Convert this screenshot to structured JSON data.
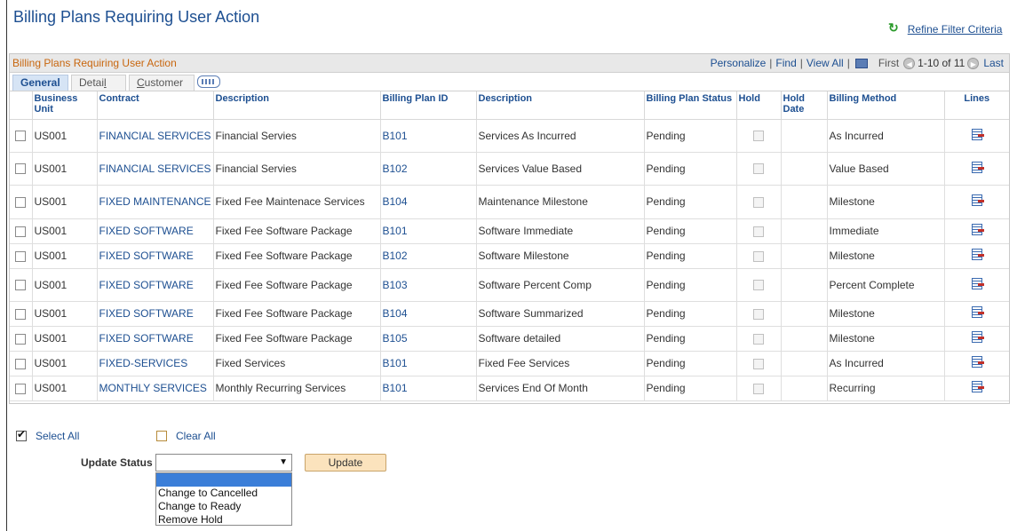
{
  "page": {
    "title": "Billing Plans Requiring User Action",
    "refine_label": "Refine Filter Criteria"
  },
  "grid": {
    "title": "Billing Plans Requiring User Action",
    "personalize": "Personalize",
    "find": "Find",
    "view_all": "View All",
    "first": "First",
    "range": "1-10 of 11",
    "last": "Last"
  },
  "tabs": {
    "general": "General",
    "detail_a": "Detai",
    "detail_b": "l",
    "customer_a": "C",
    "customer_b": "ustomer"
  },
  "columns": {
    "business_unit": "Business Unit",
    "contract": "Contract",
    "description": "Description",
    "plan_id": "Billing Plan ID",
    "plan_desc": "Description",
    "status": "Billing Plan Status",
    "hold": "Hold",
    "hold_date": "Hold Date",
    "method": "Billing Method",
    "lines": "Lines"
  },
  "rows": [
    {
      "bu": "US001",
      "contract": "FINANCIAL SERVICES",
      "desc": "Financial Servies",
      "plan_id": "B101",
      "plan_desc": "Services As Incurred",
      "status": "Pending",
      "method": "As Incurred"
    },
    {
      "bu": "US001",
      "contract": "FINANCIAL SERVICES",
      "desc": "Financial Servies",
      "plan_id": "B102",
      "plan_desc": "Services Value Based",
      "status": "Pending",
      "method": "Value Based"
    },
    {
      "bu": "US001",
      "contract": "FIXED MAINTENANCE",
      "desc": "Fixed Fee Maintenace Services",
      "plan_id": "B104",
      "plan_desc": "Maintenance Milestone",
      "status": "Pending",
      "method": "Milestone"
    },
    {
      "bu": "US001",
      "contract": "FIXED SOFTWARE",
      "desc": "Fixed Fee Software Package",
      "plan_id": "B101",
      "plan_desc": "Software Immediate",
      "status": "Pending",
      "method": "Immediate"
    },
    {
      "bu": "US001",
      "contract": "FIXED SOFTWARE",
      "desc": "Fixed Fee Software Package",
      "plan_id": "B102",
      "plan_desc": "Software Milestone",
      "status": "Pending",
      "method": "Milestone"
    },
    {
      "bu": "US001",
      "contract": "FIXED SOFTWARE",
      "desc": "Fixed Fee Software Package",
      "plan_id": "B103",
      "plan_desc": "Software Percent Comp",
      "status": "Pending",
      "method": "Percent Complete"
    },
    {
      "bu": "US001",
      "contract": "FIXED SOFTWARE",
      "desc": "Fixed Fee Software Package",
      "plan_id": "B104",
      "plan_desc": "Software Summarized",
      "status": "Pending",
      "method": "Milestone"
    },
    {
      "bu": "US001",
      "contract": "FIXED SOFTWARE",
      "desc": "Fixed Fee Software Package",
      "plan_id": "B105",
      "plan_desc": "Software detailed",
      "status": "Pending",
      "method": "Milestone"
    },
    {
      "bu": "US001",
      "contract": "FIXED-SERVICES",
      "desc": "Fixed Services",
      "plan_id": "B101",
      "plan_desc": "Fixed Fee Services",
      "status": "Pending",
      "method": "As Incurred"
    },
    {
      "bu": "US001",
      "contract": "MONTHLY SERVICES",
      "desc": "Monthly Recurring Services",
      "plan_id": "B101",
      "plan_desc": "Services End Of Month",
      "status": "Pending",
      "method": "Recurring"
    }
  ],
  "actions": {
    "select_all": "Select All",
    "clear_all": "Clear All"
  },
  "update": {
    "label": "Update Status",
    "selected": "",
    "options": [
      "",
      "Change to Cancelled",
      "Change to Ready",
      "Remove Hold"
    ],
    "button": "Update"
  }
}
